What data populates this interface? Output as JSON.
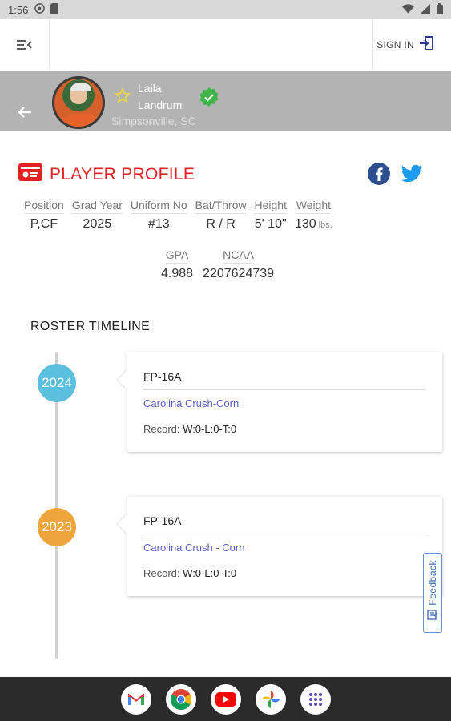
{
  "status_bar": {
    "time": "1:56"
  },
  "app_bar": {
    "sign_in_label": "SIGN IN"
  },
  "player": {
    "first_name": "Laila",
    "last_name": "Landrum",
    "location": "Simpsonville, SC"
  },
  "profile": {
    "title": "PLAYER PROFILE",
    "stats": [
      {
        "label": "Position",
        "value": "P,CF"
      },
      {
        "label": "Grad Year",
        "value": "2025"
      },
      {
        "label": "Uniform No",
        "value": "#13"
      },
      {
        "label": "Bat/Throw",
        "value": "R / R"
      },
      {
        "label": "Height",
        "value": "5' 10\""
      },
      {
        "label": "Weight",
        "value": "130",
        "unit": "lbs."
      }
    ],
    "stats2": [
      {
        "label": "GPA",
        "value": "4.988"
      },
      {
        "label": "NCAA",
        "value": "2207624739"
      }
    ]
  },
  "timeline": {
    "title": "ROSTER TIMELINE",
    "entries": [
      {
        "year": "2024",
        "team": "FP-16A",
        "club": "Carolina Crush-Corn",
        "record_label": "Record:",
        "record": "W:0-L:0-T:0",
        "color": "#5bbfde"
      },
      {
        "year": "2023",
        "team": "FP-16A",
        "club": "Carolina Crush - Corn",
        "record_label": "Record:",
        "record": "W:0-L:0-T:0",
        "color": "#eea63c"
      }
    ]
  },
  "feedback_label": "Feedback",
  "colors": {
    "accent_red": "#e32124",
    "link_purple": "#5b5fc7",
    "header_gray": "#b3b3b3"
  },
  "dock_apps": [
    "gmail-icon",
    "chrome-icon",
    "youtube-icon",
    "photos-icon",
    "app-drawer-icon"
  ]
}
